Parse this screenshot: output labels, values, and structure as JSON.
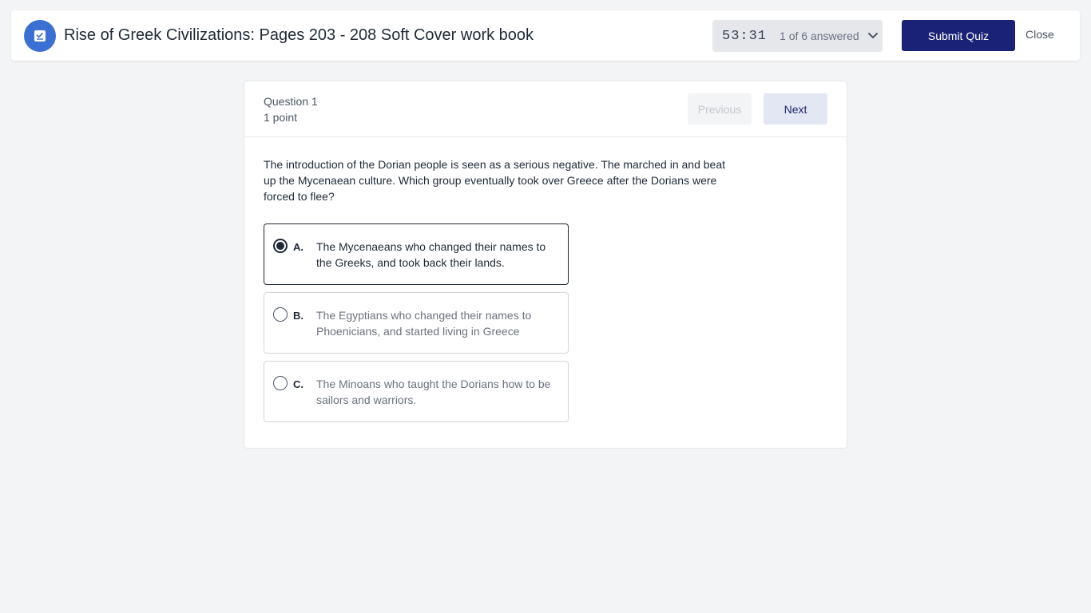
{
  "header": {
    "title": "Rise of Greek Civilizations: Pages 203 - 208 Soft Cover work book",
    "timer": "53:31",
    "answered": "1 of 6 answered",
    "submit_label": "Submit Quiz",
    "close_label": "Close",
    "badge_icon": "quiz-checklist-icon",
    "accent_color": "#3b6fd1",
    "submit_color": "#1a2277"
  },
  "question": {
    "number_label": "Question 1",
    "points_label": "1 point",
    "prev_label": "Previous",
    "next_label": "Next",
    "text": "The introduction of the Dorian people is seen as a serious negative. The marched in and beat up the Mycenaean culture. Which group eventually took over Greece after the Dorians were forced to flee?",
    "options": [
      {
        "letter": "A.",
        "text": "The Mycenaeans who changed their names to the Greeks, and took back their lands.",
        "selected": true
      },
      {
        "letter": "B.",
        "text": "The Egyptians who changed their names to Phoenicians, and started living in Greece",
        "selected": false
      },
      {
        "letter": "C.",
        "text": "The Minoans who taught the Dorians how to be sailors and warriors.",
        "selected": false
      }
    ]
  }
}
